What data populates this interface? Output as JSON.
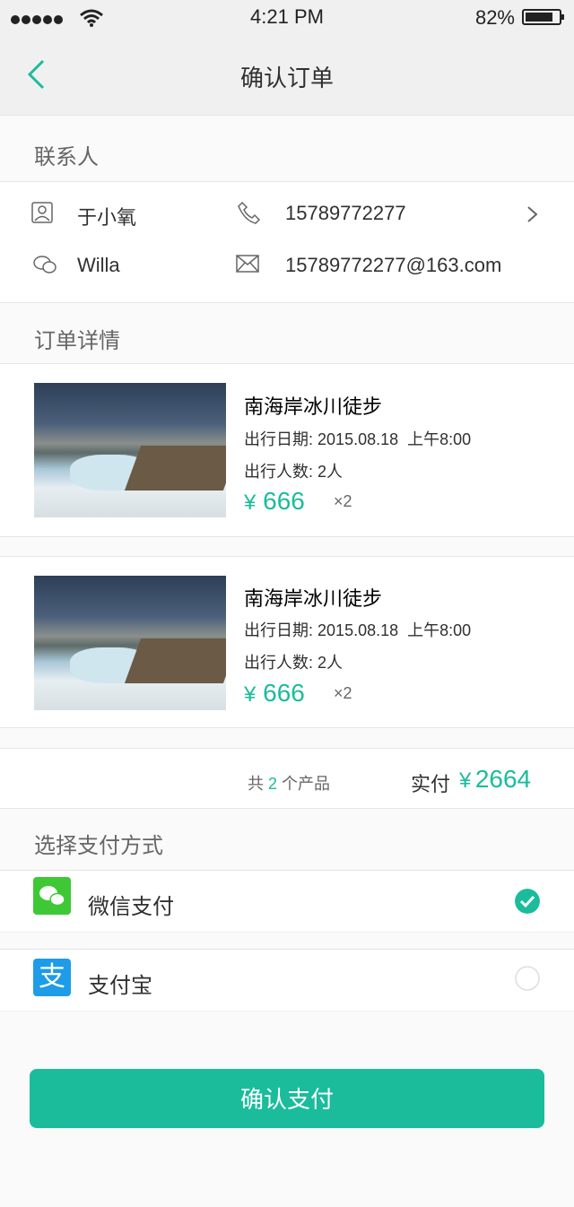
{
  "status_bar": {
    "time": "4:21 PM",
    "battery": "82%"
  },
  "nav": {
    "title": "确认订单"
  },
  "contact": {
    "section_title": "联系人",
    "name": "于小氧",
    "phone": "15789772277",
    "wechat": "Willa",
    "email": "15789772277@163.com"
  },
  "order": {
    "section_title": "订单详情",
    "items": [
      {
        "name": "南海岸冰川徒步",
        "date_label": "出行日期:",
        "date": "2015.08.18  上午8:00",
        "people_label": "出行人数:",
        "people": "2人",
        "currency": "¥",
        "price": "666",
        "qty": "×2"
      },
      {
        "name": "南海岸冰川徒步",
        "date_label": "出行日期:",
        "date": "2015.08.18  上午8:00",
        "people_label": "出行人数:",
        "people": "2人",
        "currency": "¥",
        "price": "666",
        "qty": "×2"
      }
    ],
    "summary": {
      "prefix": "共",
      "count": "2",
      "suffix": "个产品",
      "paid_label": "实付",
      "currency": "¥",
      "total": "2664"
    }
  },
  "payment": {
    "section_title": "选择支付方式",
    "methods": [
      {
        "label": "微信支付",
        "selected": true
      },
      {
        "label": "支付宝",
        "selected": false
      }
    ]
  },
  "confirm_button": "确认支付",
  "colors": {
    "accent": "#1abc9c",
    "text_dark": "#303030",
    "text_gray": "#666666",
    "divider": "#e5e5e5",
    "page_bg": "#fafafa"
  }
}
